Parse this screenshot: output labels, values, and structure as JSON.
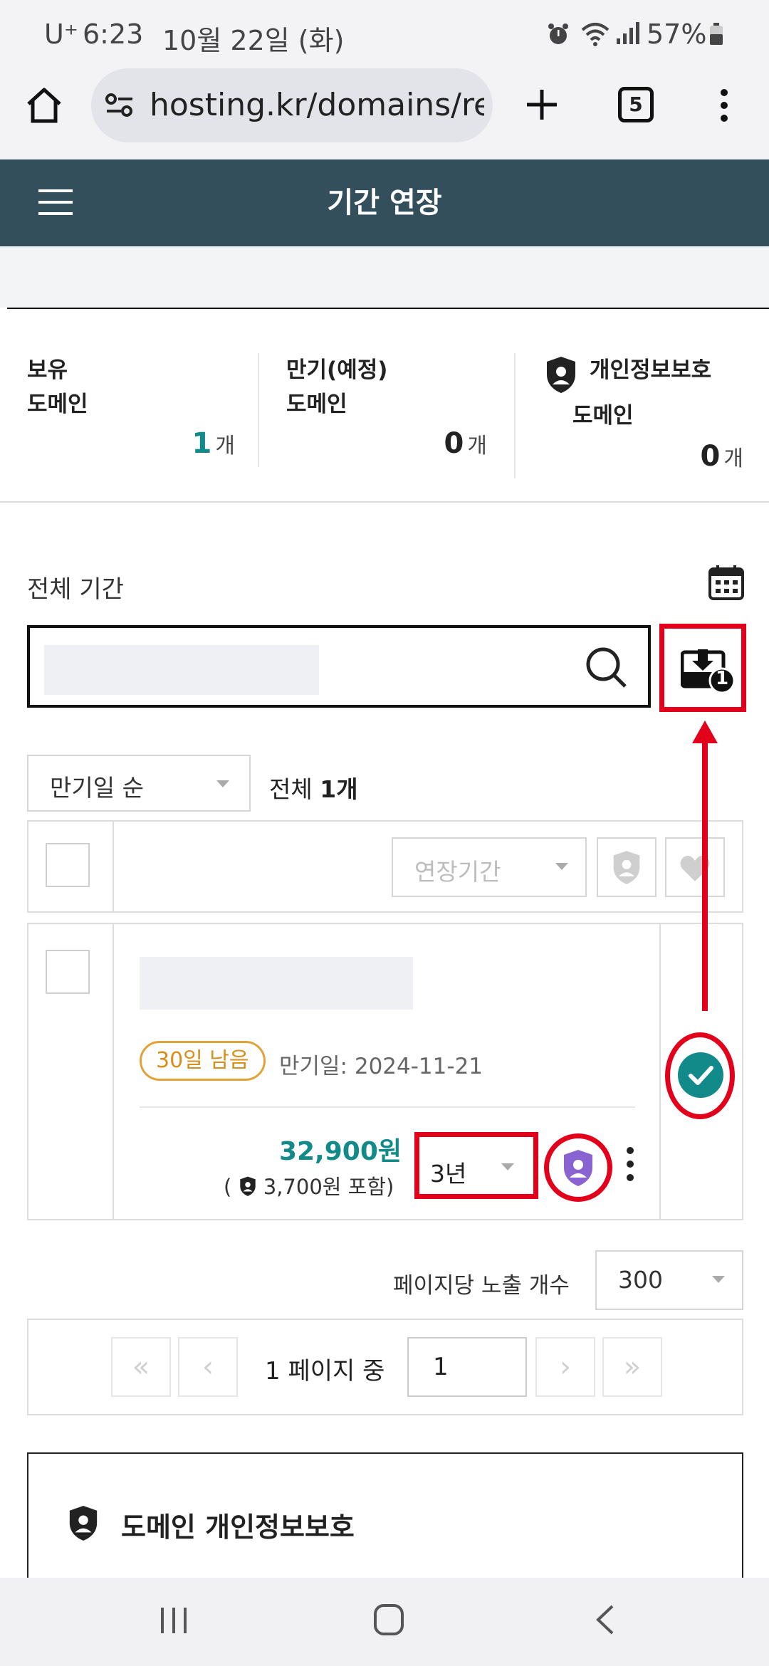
{
  "status": {
    "carrier": "U⁺",
    "time": "6:23",
    "date": "10월 22일 (화)",
    "battery": "57%"
  },
  "browser": {
    "url": "hosting.kr/domains/re",
    "tab_count": "5"
  },
  "header": {
    "title": "기간 연장"
  },
  "summary": {
    "owned_label_1": "보유",
    "owned_label_2": "도메인",
    "owned_count": "1",
    "owned_unit": "개",
    "expiring_label_1": "만기(예정)",
    "expiring_label_2": "도메인",
    "expiring_count": "0",
    "expiring_unit": "개",
    "privacy_label_1": "개인정보보호",
    "privacy_label_2": "도메인",
    "privacy_count": "0",
    "privacy_unit": "개",
    "accent_color": "#138a8a"
  },
  "filter": {
    "period_label": "전체 기간",
    "download_badge": "1"
  },
  "sort": {
    "selected": "만기일 순",
    "total_label": "전체",
    "total_count": "1개"
  },
  "bulk": {
    "period_placeholder": "연장기간"
  },
  "item": {
    "days_left": "30일 남음",
    "expiry": "만기일: 2024-11-21",
    "price": "32,900원",
    "price_note_open": "(",
    "price_note": "3,700원 포함)",
    "period": "3년"
  },
  "pagination": {
    "per_page_label": "페이지당 노출 개수",
    "per_page_value": "300",
    "page_text": "1 페이지 중",
    "page_input": "1"
  },
  "privacy_section": {
    "title": "도메인 개인정보보호"
  },
  "icons": [
    "home-icon",
    "site-settings-icon",
    "plus-icon",
    "tabs-icon",
    "more-vert-icon",
    "menu-icon",
    "shield-icon",
    "calendar-icon",
    "search-icon",
    "download-icon",
    "check-circle-icon",
    "heart-icon"
  ]
}
